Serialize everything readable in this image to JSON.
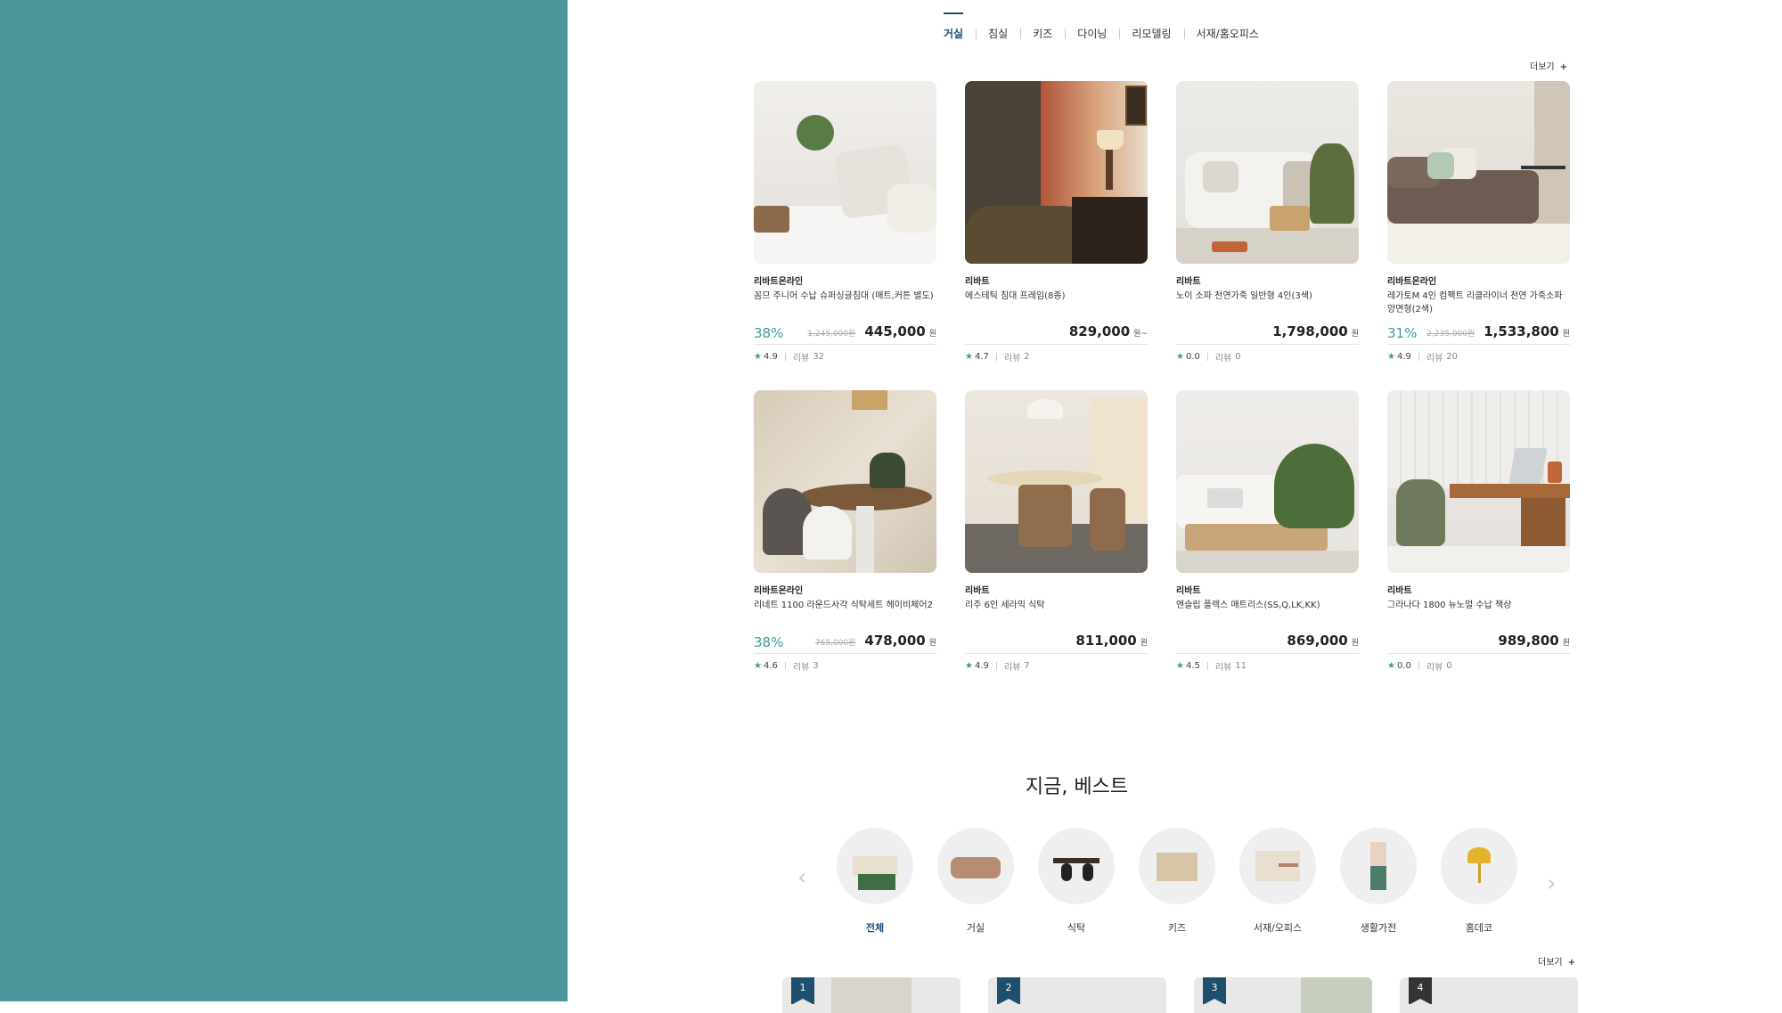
{
  "tabs": [
    "거실",
    "침실",
    "키즈",
    "다이닝",
    "리모델링",
    "서재/홈오피스"
  ],
  "more_label": "더보기",
  "plus": "+",
  "products": [
    {
      "brand": "리바트온라인",
      "name": "꼼므 주니어 수납 슈퍼싱글침대 (매트,커튼 별도)",
      "discount": "38%",
      "original": "1,245,000원",
      "price": "445,000",
      "unit": "원",
      "rating": "4.9",
      "review_label": "리뷰",
      "reviews": "32"
    },
    {
      "brand": "리바트",
      "name": "에스테틱 침대 프레임(8종)",
      "discount": "",
      "original": "",
      "price": "829,000",
      "unit": "원~",
      "rating": "4.7",
      "review_label": "리뷰",
      "reviews": "2"
    },
    {
      "brand": "리바트",
      "name": "노이 소파 천연가죽 일반형 4인(3색)",
      "discount": "",
      "original": "",
      "price": "1,798,000",
      "unit": "원",
      "rating": "0.0",
      "review_label": "리뷰",
      "reviews": "0"
    },
    {
      "brand": "리바트온라인",
      "name": "레가토M 4인 컴팩트 리클라이너 천연 가죽소파 양면형(2색)",
      "discount": "31%",
      "original": "2,235,000원",
      "price": "1,533,800",
      "unit": "원",
      "rating": "4.9",
      "review_label": "리뷰",
      "reviews": "20"
    },
    {
      "brand": "리바트온라인",
      "name": "리네트 1100 라운드사각 식탁세트 헤이비체어2",
      "discount": "38%",
      "original": "765,000원",
      "price": "478,000",
      "unit": "원",
      "rating": "4.6",
      "review_label": "리뷰",
      "reviews": "3"
    },
    {
      "brand": "리바트",
      "name": "리주 6인 세라믹 식탁",
      "discount": "",
      "original": "",
      "price": "811,000",
      "unit": "원",
      "rating": "4.9",
      "review_label": "리뷰",
      "reviews": "7"
    },
    {
      "brand": "리바트",
      "name": "엔슬립 플렉스 매트리스(SS,Q,LK,KK)",
      "discount": "",
      "original": "",
      "price": "869,000",
      "unit": "원",
      "rating": "4.5",
      "review_label": "리뷰",
      "reviews": "11"
    },
    {
      "brand": "리바트",
      "name": "그라나다 1800 뉴노멀 수납 책상",
      "discount": "",
      "original": "",
      "price": "989,800",
      "unit": "원",
      "rating": "0.0",
      "review_label": "리뷰",
      "reviews": "0"
    }
  ],
  "best": {
    "title": "지금, 베스트",
    "categories": [
      "전체",
      "거실",
      "식탁",
      "키즈",
      "서재/오피스",
      "생활가전",
      "홈데코"
    ],
    "ranks": [
      "1",
      "2",
      "3",
      "4"
    ]
  },
  "icons": {
    "prev": "chevron-left-icon",
    "next": "chevron-right-icon",
    "star": "star-icon"
  },
  "colors": {
    "teal_panel": "#4a969a",
    "accent": "#3a9b9a",
    "navy": "#1b4f7a"
  }
}
